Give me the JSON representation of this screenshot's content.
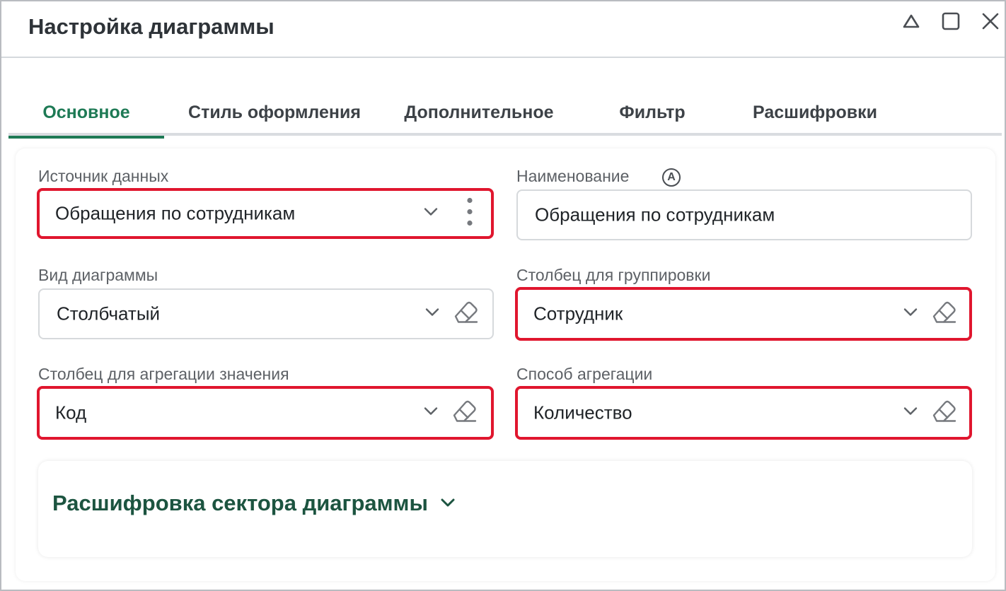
{
  "window": {
    "title": "Настройка диаграммы",
    "controls": [
      "collapse-icon",
      "maximize-icon",
      "close-icon"
    ]
  },
  "tabs": [
    {
      "label": "Основное",
      "active": true
    },
    {
      "label": "Стиль оформления",
      "active": false
    },
    {
      "label": "Дополнительное",
      "active": false
    },
    {
      "label": "Фильтр",
      "active": false
    },
    {
      "label": "Расшифровки",
      "active": false
    }
  ],
  "form": {
    "data_source": {
      "label": "Источник данных",
      "value": "Обращения по сотрудникам"
    },
    "name": {
      "label": "Наименование",
      "badge": "A",
      "value": "Обращения по сотрудникам"
    },
    "chart_type": {
      "label": "Вид диаграммы",
      "value": "Столбчатый"
    },
    "group_column": {
      "label": "Столбец для группировки",
      "value": "Сотрудник"
    },
    "value_column": {
      "label": "Столбец для агрегации значения",
      "value": "Код"
    },
    "aggregation": {
      "label": "Способ агрегации",
      "value": "Количество"
    }
  },
  "section": {
    "title": "Расшифровка сектора диаграммы"
  },
  "colors": {
    "accent": "#1e7a55",
    "highlight": "#e0162e",
    "section_title": "#1c5440"
  }
}
